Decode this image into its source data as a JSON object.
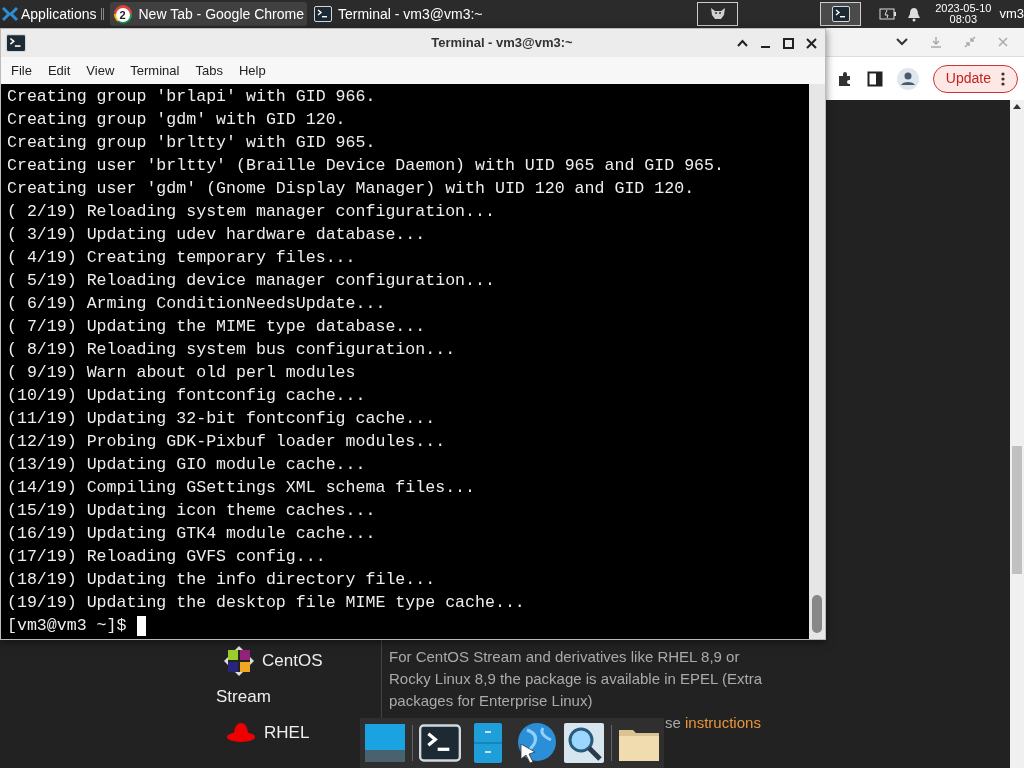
{
  "panel": {
    "menu": "Applications",
    "tasks": [
      {
        "kind": "browser",
        "title": "New Tab - Google Chrome",
        "badge": "2",
        "selected": true
      },
      {
        "kind": "terminal",
        "title": "Terminal - vm3@vm3:~",
        "selected": false
      }
    ],
    "launchers": [
      {
        "kind": "cat",
        "selected": false
      },
      {
        "kind": "terminal",
        "selected": true
      }
    ],
    "date": "2023-05-10",
    "time": "08:03",
    "user": "vm3"
  },
  "browser": {
    "update_button": "Update",
    "distros": [
      {
        "kind": "centos",
        "name": "CentOS",
        "name_line2": "Stream"
      },
      {
        "kind": "rhel",
        "name": "RHEL"
      }
    ],
    "paragraph": "For CentOS Stream and derivatives like RHEL 8,9 or Rocky Linux 8,9 the package is available in EPEL (Extra packages for Enterprise Linux)",
    "note_tail": "se",
    "link": "instructions"
  },
  "terminal": {
    "title": "Terminal - vm3@vm3:~",
    "menu": [
      "File",
      "Edit",
      "View",
      "Terminal",
      "Tabs",
      "Help"
    ],
    "lines": [
      "Creating group 'brlapi' with GID 966.",
      "Creating group 'gdm' with GID 120.",
      "Creating group 'brltty' with GID 965.",
      "Creating user 'brltty' (Braille Device Daemon) with UID 965 and GID 965.",
      "Creating user 'gdm' (Gnome Display Manager) with UID 120 and GID 120.",
      "( 2/19) Reloading system manager configuration...",
      "( 3/19) Updating udev hardware database...",
      "( 4/19) Creating temporary files...",
      "( 5/19) Reloading device manager configuration...",
      "( 6/19) Arming ConditionNeedsUpdate...",
      "( 7/19) Updating the MIME type database...",
      "( 8/19) Reloading system bus configuration...",
      "( 9/19) Warn about old perl modules",
      "(10/19) Updating fontconfig cache...",
      "(11/19) Updating 32-bit fontconfig cache...",
      "(12/19) Probing GDK-Pixbuf loader modules...",
      "(13/19) Updating GIO module cache...",
      "(14/19) Compiling GSettings XML schema files...",
      "(15/19) Updating icon theme caches...",
      "(16/19) Updating GTK4 module cache...",
      "(17/19) Reloading GVFS config...",
      "(18/19) Updating the info directory file...",
      "(19/19) Updating the desktop file MIME type cache..."
    ],
    "prompt": "[vm3@vm3 ~]$"
  },
  "dock": [
    {
      "kind": "desktop"
    },
    {
      "kind": "terminal"
    },
    {
      "kind": "cabinet"
    },
    {
      "kind": "globe"
    },
    {
      "kind": "search"
    },
    {
      "kind": "folder"
    }
  ]
}
